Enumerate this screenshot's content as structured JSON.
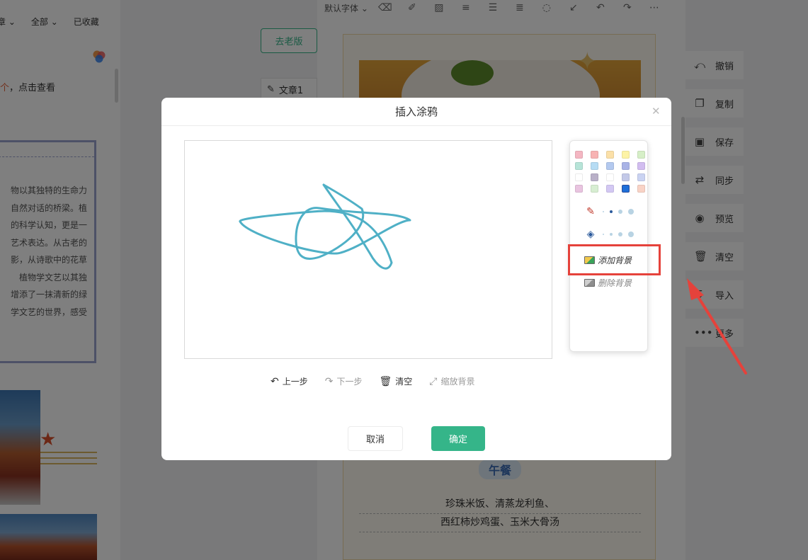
{
  "left_panel": {
    "filters": [
      "章",
      "全部",
      "已收藏"
    ],
    "notice": {
      "prefix": "个",
      "text": "，点击查看"
    },
    "article_lines": [
      "物以其独特的生命力",
      "自然对话的桥梁。植",
      "的科学认知，更是一",
      "艺术表达。从古老的",
      "影，从诗歌中的花草",
      "植物学文艺以其独",
      "增添了一抹清新的绿",
      "学文艺的世界，感受"
    ]
  },
  "workspace": {
    "old_version_button": "去老版",
    "article_tab": "文章1"
  },
  "editor": {
    "font_selector": "默认字体",
    "lunch_title": "午餐",
    "menu_lines": [
      "珍珠米饭、清蒸龙利鱼、",
      "西红柿炒鸡蛋、玉米大骨汤"
    ]
  },
  "right_rail": [
    {
      "label": "撤销",
      "icon": "undo-icon",
      "glyph": "⤺"
    },
    {
      "label": "复制",
      "icon": "copy-icon",
      "glyph": "❐"
    },
    {
      "label": "保存",
      "icon": "save-icon",
      "glyph": "▣"
    },
    {
      "label": "同步",
      "icon": "sync-icon",
      "glyph": "⇄"
    },
    {
      "label": "预览",
      "icon": "eye-icon",
      "glyph": "◉"
    },
    {
      "label": "清空",
      "icon": "trash-icon",
      "glyph": "🗑"
    },
    {
      "label": "导入",
      "icon": "import-icon",
      "glyph": "↧"
    },
    {
      "label": "更多",
      "icon": "more-icon",
      "glyph": "•••"
    }
  ],
  "modal": {
    "title": "插入涂鸦",
    "swatches": [
      "#f4b6c2",
      "#f7b3b3",
      "#fbe0a8",
      "#fdf3a6",
      "#d6efc7",
      "#b7e4d8",
      "#b6dcf4",
      "#b3c9ef",
      "#a9b3e6",
      "#d2bdf0",
      "#ffffff",
      "#b9b0c8",
      "#ffffff",
      "#c3c9e8",
      "#cad3f2",
      "#e9c4e0",
      "#d7eed2",
      "#d3c8f3",
      "#1e6fd9",
      "#f9d3c6"
    ],
    "selected_swatch": 18,
    "pen_tool_icon": "pen-icon",
    "eraser_tool_icon": "eraser-icon",
    "add_background": "添加背景",
    "delete_background": "删除背景",
    "actions": {
      "undo": "上一步",
      "redo": "下一步",
      "clear": "清空",
      "zoom_background": "缩放背景"
    },
    "cancel": "取消",
    "confirm": "确定",
    "stroke_color": "#4fb0c6",
    "selection_highlight_color": "#e5423b"
  }
}
